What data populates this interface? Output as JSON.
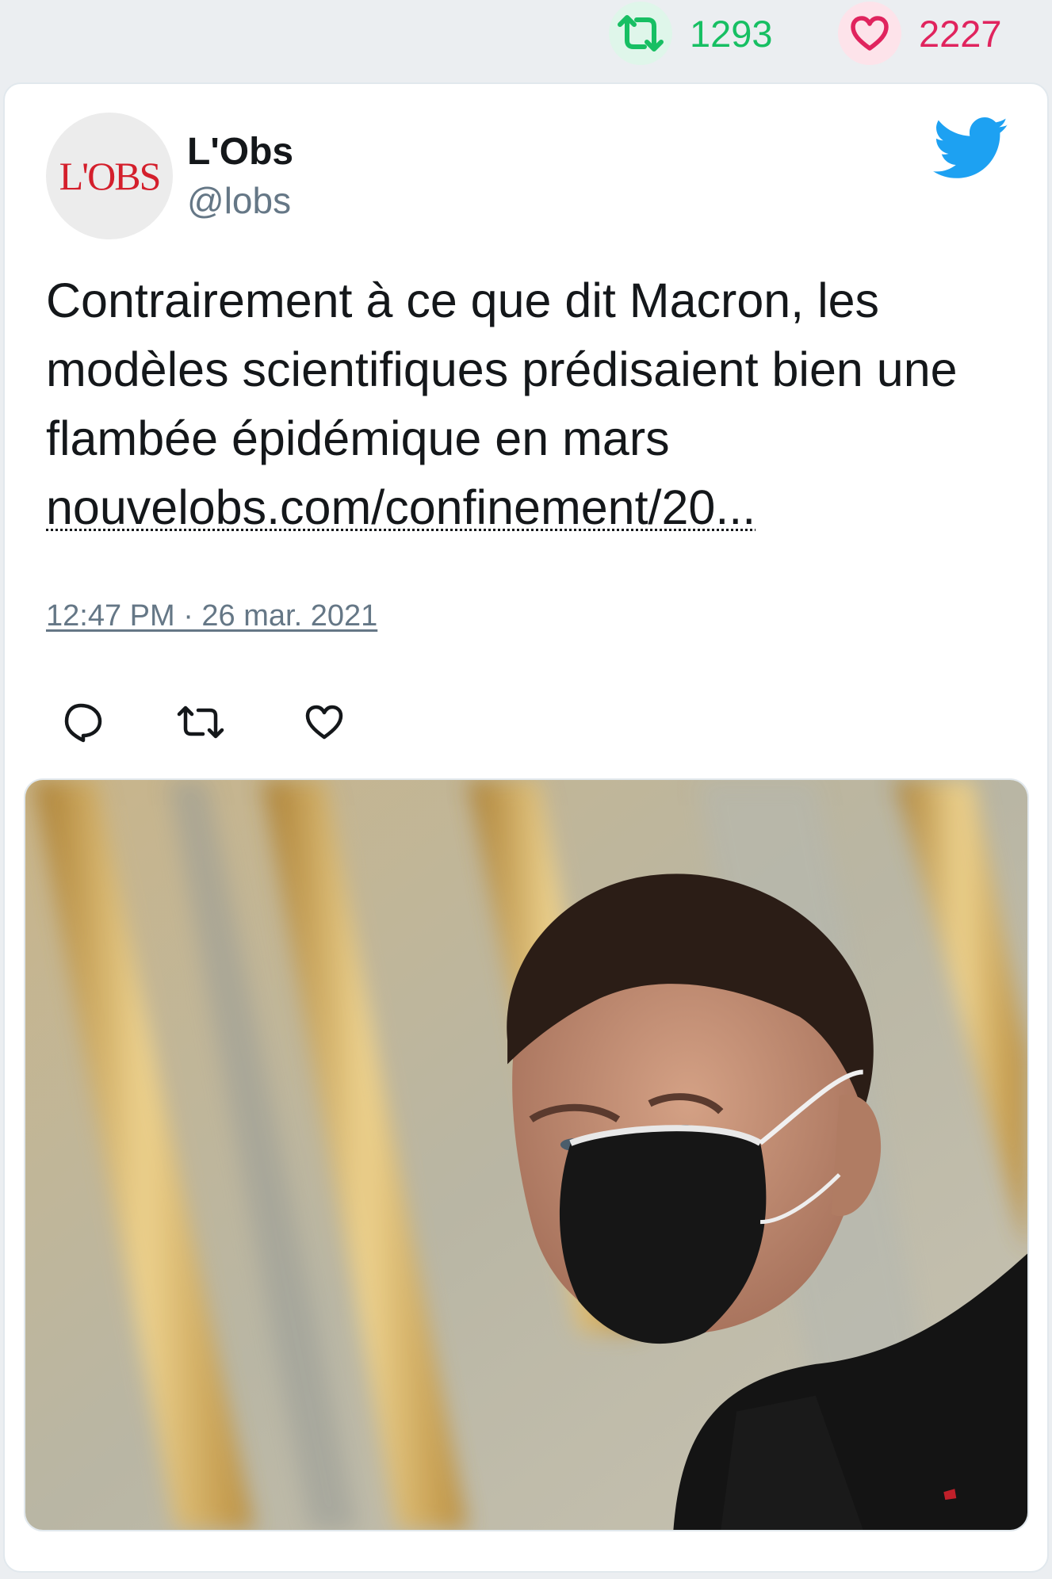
{
  "stats": {
    "retweets": "1293",
    "likes": "2227"
  },
  "tweet": {
    "display_name": "L'Obs",
    "handle": "@lobs",
    "avatar_text": "L'OBS",
    "text": "Contrairement à ce que dit Macron, les modèles scientifiques prédisaient bien une flambée épidémique en mars",
    "link": "nouvelobs.com/confinement/20...",
    "timestamp": "12:47 PM · 26 mar. 2021"
  },
  "colors": {
    "retweet_green": "#17bf63",
    "like_red": "#e0245e",
    "twitter_blue": "#1da1f2",
    "muted": "#657786"
  },
  "icons": {
    "retweet": "retweet-icon",
    "like": "heart-icon",
    "reply": "reply-icon",
    "brand": "twitter-bird-icon"
  }
}
